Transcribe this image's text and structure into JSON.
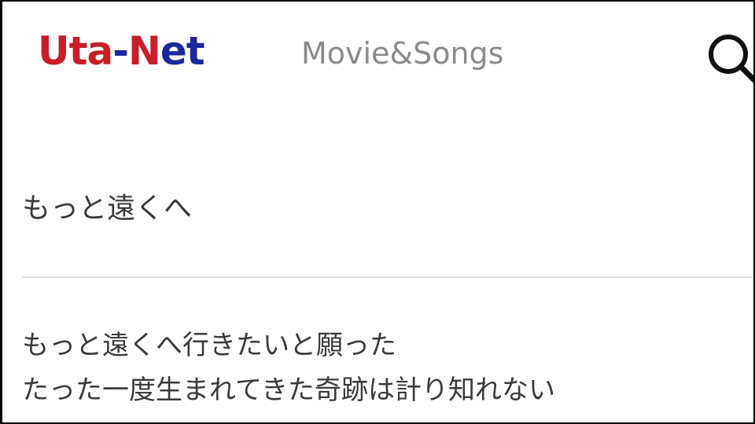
{
  "header": {
    "logo": {
      "part1": "Uta",
      "dash": "-",
      "part2": "N",
      "part3": "et"
    },
    "tagline": "Movie&Songs",
    "search_icon": "search-icon"
  },
  "song": {
    "title": "もっと遠くへ",
    "lyrics": [
      "もっと遠くへ行きたいと願った",
      "たった一度生まれてきた奇跡は計り知れない"
    ]
  },
  "colors": {
    "logo_red": "#c81e28",
    "logo_blue": "#1a2a9c",
    "tagline_gray": "#8a8a8a",
    "text": "#3a3a3a",
    "divider": "#e2e2e2"
  }
}
